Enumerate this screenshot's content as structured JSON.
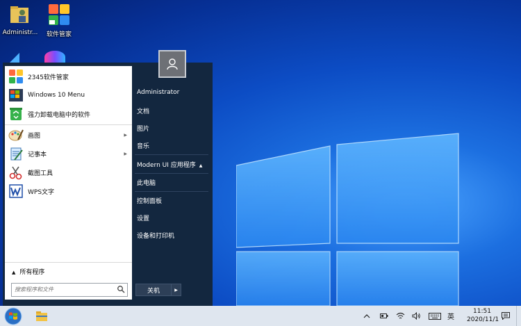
{
  "desktop": {
    "icons": [
      {
        "label": "Administr...",
        "icon": "user-folder-icon"
      },
      {
        "label": "软件管家",
        "icon": "software-manager-icon"
      }
    ]
  },
  "start_menu": {
    "pinned": [
      {
        "label": "2345软件管家",
        "icon": "software-manager-icon"
      },
      {
        "label": "Windows 10 Menu",
        "icon": "windows-menu-icon"
      },
      {
        "label": "强力卸载电脑中的软件",
        "icon": "recycle-uninstall-icon"
      }
    ],
    "recent": [
      {
        "label": "画图",
        "icon": "paint-icon",
        "has_submenu": true
      },
      {
        "label": "记事本",
        "icon": "notepad-icon",
        "has_submenu": true
      },
      {
        "label": "截图工具",
        "icon": "snipping-tool-icon",
        "has_submenu": false
      },
      {
        "label": "WPS文字",
        "icon": "wps-writer-icon",
        "has_submenu": false
      }
    ],
    "all_programs": "所有程序",
    "search_placeholder": "搜索程序和文件",
    "right": {
      "user_name": "Administrator",
      "documents": "文档",
      "pictures": "图片",
      "music": "音乐",
      "modern_ui": "Modern UI 应用程序",
      "this_pc": "此电脑",
      "control_panel": "控制面板",
      "settings": "设置",
      "devices_printers": "设备和打印机"
    },
    "shutdown_label": "关机"
  },
  "taskbar": {
    "ime": "英",
    "time": "11:51",
    "date": "2020/11/1"
  },
  "colors": {
    "desktop_blue": "#0c4cc4",
    "start_menu_bg": "#13273f",
    "taskbar_bg": "#dfe6ef"
  }
}
